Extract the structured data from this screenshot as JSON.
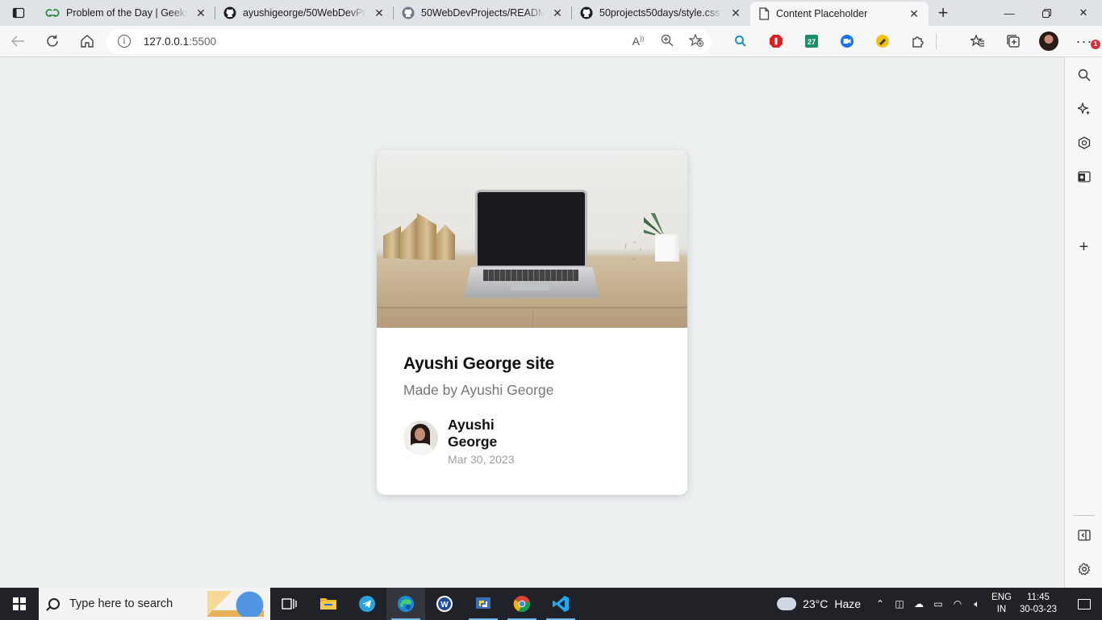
{
  "browser": {
    "tabs": [
      {
        "title": "Problem of the Day | Geeksfo",
        "icon": "geeksforgeeks-icon",
        "icon_color": "#2f8d46"
      },
      {
        "title": "ayushigeorge/50WebDevProj",
        "icon": "github-icon",
        "icon_color": "#1b1f23"
      },
      {
        "title": "50WebDevProjects/README.",
        "icon": "github-icon",
        "icon_color": "#6e7781"
      },
      {
        "title": "50projects50days/style.css at",
        "icon": "github-icon",
        "icon_color": "#1b1f23"
      },
      {
        "title": "Content Placeholder",
        "icon": "document-icon",
        "icon_color": "#444444",
        "active": true
      }
    ],
    "address": {
      "host": "127.0.0.1",
      "port": ":5500"
    },
    "notification_count": "1"
  },
  "card": {
    "title": "Ayushi George site",
    "subtitle": "Made by Ayushi George",
    "author_name": "Ayushi George",
    "date": "Mar 30, 2023"
  },
  "taskbar": {
    "search_placeholder": "Type here to search",
    "weather": {
      "temp": "23°C",
      "condition": "Haze"
    },
    "language": {
      "line1": "ENG",
      "line2": "IN"
    },
    "clock": {
      "time": "11:45",
      "date": "30-03-23"
    }
  },
  "colors": {
    "page_background": "#ecf0f1",
    "card_background": "#ffffff",
    "taskbar": "#202228",
    "edge_accent": "#0078d4"
  }
}
